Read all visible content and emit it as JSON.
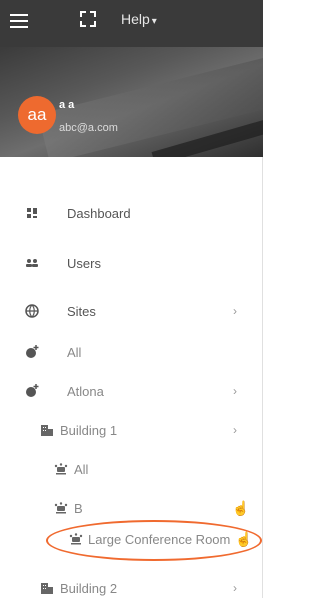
{
  "topbar": {
    "menu_icon": "hamburger-icon",
    "fullscreen_icon": "fullscreen-icon",
    "help_label": "Help"
  },
  "profile": {
    "avatar_initials": "aa",
    "name": "a a",
    "email": "abc@a.com"
  },
  "nav": [
    {
      "label": "Dashboard",
      "icon": "dashboard-icon",
      "has_arrow": false
    },
    {
      "label": "Users",
      "icon": "users-icon",
      "has_arrow": false
    },
    {
      "label": "Sites",
      "icon": "globe-icon",
      "has_arrow": true
    },
    {
      "label": "All",
      "icon": "globe-add-icon",
      "has_arrow": false
    },
    {
      "label": "Atlona",
      "icon": "globe-add-icon",
      "has_arrow": true
    },
    {
      "label": "Building 1",
      "icon": "building-icon",
      "has_arrow": true
    },
    {
      "label": "All",
      "icon": "room-icon",
      "has_arrow": false
    },
    {
      "label": "B",
      "icon": "room-icon",
      "has_arrow": false
    },
    {
      "label": "Large Conference Room",
      "icon": "room-icon",
      "has_arrow": false
    },
    {
      "label": "Building 2",
      "icon": "building-icon",
      "has_arrow": true
    }
  ],
  "colors": {
    "accent": "#ee6a2f",
    "topbar": "#3a3a3a"
  }
}
